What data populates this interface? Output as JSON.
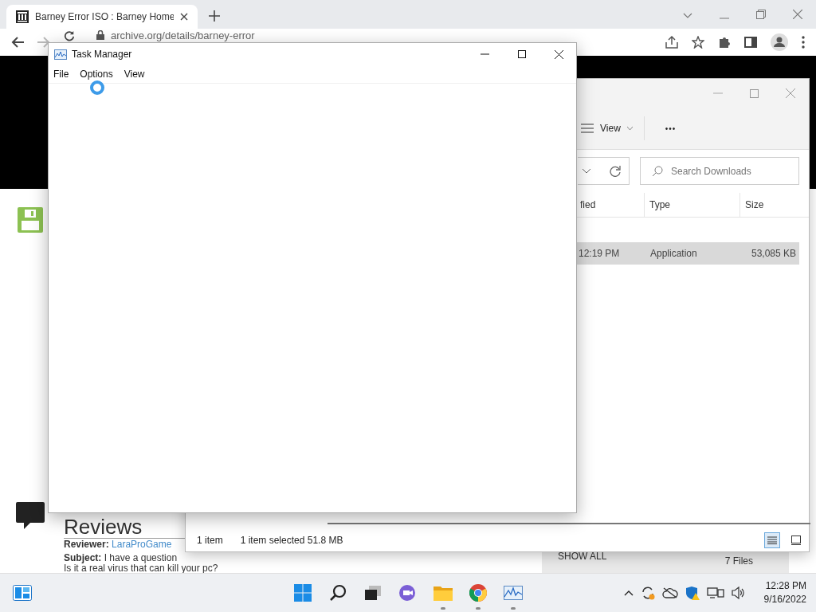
{
  "browser": {
    "tabs": [
      {
        "title": "Barney Error ISO : Barney Home",
        "selected": true
      }
    ],
    "url": "archive.org/details/barney-error"
  },
  "page": {
    "heading": "Reviews",
    "reviewer_label": "Reviewer:",
    "reviewer": "LaraProGame",
    "subject_label": "Subject:",
    "subject": "I have a question",
    "body": "Is it a real virus that can kill your pc?"
  },
  "downloads_bar": {
    "button": "SHOW ALL",
    "count": "7 Files"
  },
  "explorer": {
    "toolbar": {
      "view": "View",
      "more": "•••"
    },
    "search": {
      "placeholder": "Search Downloads"
    },
    "columns": [
      "fied",
      "Type",
      "Size"
    ],
    "rows": [
      {
        "cells": [
          "12:19 PM",
          "Application",
          "53,085 KB"
        ],
        "selected": true
      }
    ],
    "status": [
      "1 item",
      "1 item selected  51.8 MB"
    ],
    "views": [
      {
        "kind": "details",
        "selected": true
      },
      {
        "kind": "tiles",
        "selected": false
      }
    ]
  },
  "task_manager": {
    "title": "Task Manager",
    "menu": [
      "File",
      "Options",
      "View"
    ],
    "loading": true
  },
  "taskbar": {
    "apps": [
      {
        "kind": "start",
        "running": false
      },
      {
        "kind": "search",
        "running": false
      },
      {
        "kind": "taskview",
        "running": false
      },
      {
        "kind": "chat",
        "running": false
      },
      {
        "kind": "explorer",
        "running": true
      },
      {
        "kind": "chrome",
        "running": true
      },
      {
        "kind": "taskmanager",
        "running": true
      }
    ],
    "clock": {
      "time": "12:28 PM",
      "date": "9/16/2022"
    }
  }
}
